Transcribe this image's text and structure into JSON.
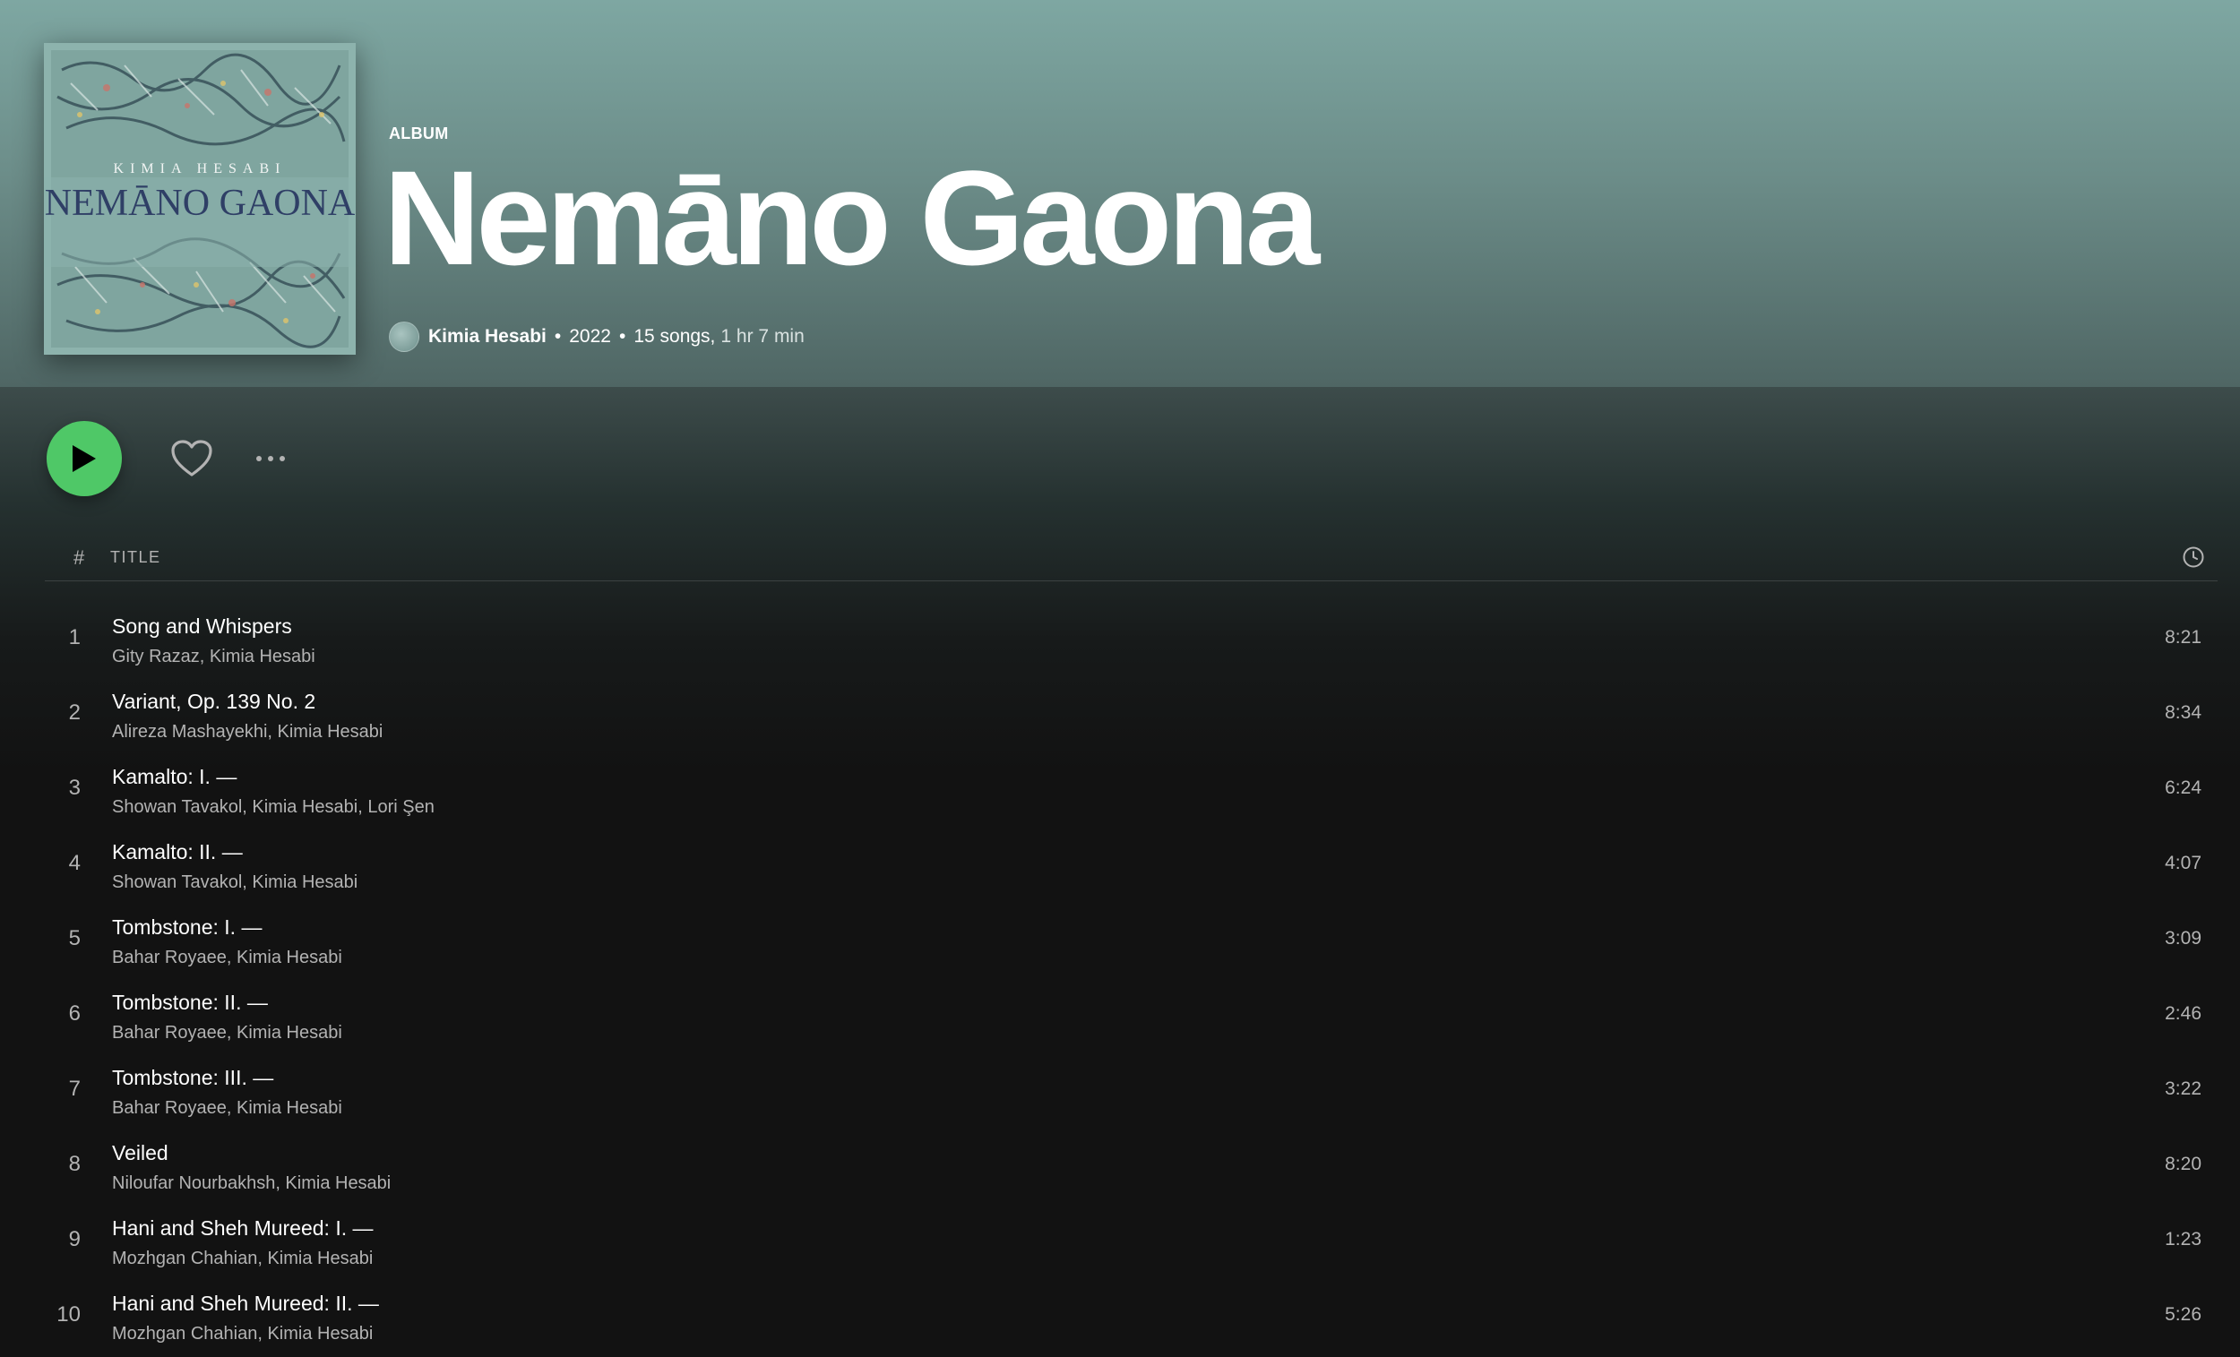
{
  "album": {
    "type_label": "ALBUM",
    "title": "Nemāno Gaona",
    "cover_text_top": "KIMIA HESABI",
    "cover_text_main": "NEMĀNO GAONA",
    "artist": "Kimia Hesabi",
    "separator": "•",
    "year": "2022",
    "song_count": "15 songs,",
    "duration": "1 hr 7 min"
  },
  "colors": {
    "header_bg": "#7ea7a2",
    "play_button": "#4fc867",
    "background": "#121212",
    "muted_text": "#b3b3b3"
  },
  "actions": {
    "play_icon": "play-icon",
    "like_icon": "heart-icon",
    "more_icon": "more-icon"
  },
  "list_header": {
    "number": "#",
    "title": "TITLE",
    "duration_icon": "clock-icon"
  },
  "tracks": [
    {
      "number": "1",
      "title": "Song and Whispers",
      "artists": "Gity Razaz, Kimia Hesabi",
      "duration": "8:21"
    },
    {
      "number": "2",
      "title": "Variant, Op. 139 No. 2",
      "artists": "Alireza Mashayekhi, Kimia Hesabi",
      "duration": "8:34"
    },
    {
      "number": "3",
      "title": "Kamalto: I. —",
      "artists": "Showan Tavakol, Kimia Hesabi, Lori Şen",
      "duration": "6:24"
    },
    {
      "number": "4",
      "title": "Kamalto: II. —",
      "artists": "Showan Tavakol, Kimia Hesabi",
      "duration": "4:07"
    },
    {
      "number": "5",
      "title": "Tombstone: I. —",
      "artists": "Bahar Royaee, Kimia Hesabi",
      "duration": "3:09"
    },
    {
      "number": "6",
      "title": "Tombstone: II. —",
      "artists": "Bahar Royaee, Kimia Hesabi",
      "duration": "2:46"
    },
    {
      "number": "7",
      "title": "Tombstone: III. —",
      "artists": "Bahar Royaee, Kimia Hesabi",
      "duration": "3:22"
    },
    {
      "number": "8",
      "title": "Veiled",
      "artists": "Niloufar Nourbakhsh, Kimia Hesabi",
      "duration": "8:20"
    },
    {
      "number": "9",
      "title": "Hani and Sheh Mureed: I. —",
      "artists": "Mozhgan Chahian, Kimia Hesabi",
      "duration": "1:23"
    },
    {
      "number": "10",
      "title": "Hani and Sheh Mureed: II. —",
      "artists": "Mozhgan Chahian, Kimia Hesabi",
      "duration": "5:26"
    }
  ]
}
